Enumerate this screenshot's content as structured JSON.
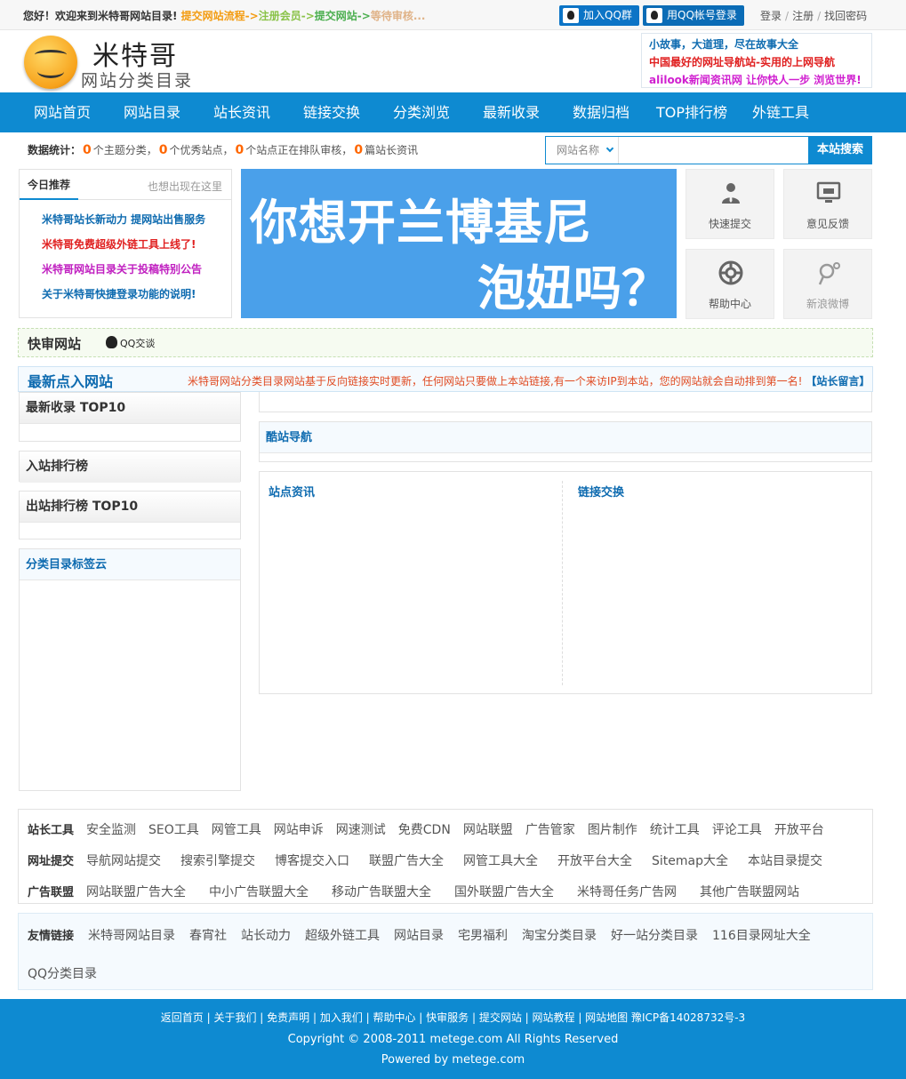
{
  "topbar": {
    "welcome": "您好！欢迎来到米特哥网站目录!",
    "steps": [
      "提交网站流程->",
      "注册会员->",
      "提交网站->",
      "等待审核..."
    ],
    "step_colors": [
      "#f39c12",
      "#8bc34a",
      "#4caf50",
      "#e0b388"
    ],
    "qq_group": "加入QQ群",
    "qq_login": "用QQ帐号登录",
    "links": [
      "登录",
      "注册",
      "找回密码"
    ]
  },
  "header": {
    "logo_name": "米特哥",
    "logo_sub": "网站分类目录",
    "ad_lines": [
      {
        "text": "小故事，大道理，尽在故事大全",
        "color": "#0e6bb0"
      },
      {
        "text": "中国最好的网址导航站-实用的上网导航",
        "color": "#e02020"
      },
      {
        "text": "alilook新闻资讯网 让你快人一步 浏览世界!",
        "color": "#d020d0"
      }
    ]
  },
  "nav": [
    "网站首页",
    "网站目录",
    "站长资讯",
    "链接交换",
    "分类浏览",
    "最新收录",
    "数据归档",
    "TOP排行榜",
    "外链工具"
  ],
  "stats": {
    "label": "数据统计：",
    "categories": "0",
    "categories_text": "个主题分类，",
    "sites": "0",
    "sites_text": "个优秀站点，",
    "pending": "0",
    "pending_text": "个站点正在排队审核，",
    "articles": "0",
    "articles_text": "篇站长资讯"
  },
  "search": {
    "select_label": "网站名称",
    "button": "本站搜索"
  },
  "recommend": {
    "tab_active": "今日推荐",
    "tab_other": "也想出现在这里",
    "items": [
      {
        "text": "米特哥站长新动力 提网站出售服务",
        "color": "#0e6bb0"
      },
      {
        "text": "米特哥免费超级外链工具上线了!",
        "color": "#e02020"
      },
      {
        "text": "米特哥网站目录关于投稿特别公告",
        "color": "#c020c0"
      },
      {
        "text": "关于米特哥快捷登录功能的说明!",
        "color": "#0e6bb0"
      }
    ]
  },
  "banner": {
    "line1": "你想开兰博基尼",
    "line2": "泡妞吗？"
  },
  "tiles": [
    "快速提交",
    "意见反馈",
    "帮助中心",
    "新浪微博"
  ],
  "quick_review": {
    "title": "快审网站",
    "qq": "QQ交谈"
  },
  "latest": {
    "title": "最新点入网站",
    "message": "米特哥网站分类目录网站基于反向链接实时更新，任何网站只要做上本站链接,有一个来访IP到本站，您的网站就会自动排到第一名!",
    "guestbook": "【站长留言】"
  },
  "sidebar": {
    "top10": "最新收录 TOP10",
    "in_rank": "入站排行榜",
    "out_rank": "出站排行榜 TOP10",
    "tags": "分类目录标签云"
  },
  "main": {
    "cool_nav": "酷站导航",
    "news": "站点资讯",
    "exchange": "链接交换"
  },
  "tools": {
    "rows": [
      {
        "label": "站长工具",
        "items": [
          "安全监测",
          "SEO工具",
          "网管工具",
          "网站申诉",
          "网速测试",
          "免费CDN",
          "网站联盟",
          "广告管家",
          "图片制作",
          "统计工具",
          "评论工具",
          "开放平台"
        ]
      },
      {
        "label": "网址提交",
        "items": [
          "导航网站提交",
          "搜索引擎提交",
          "博客提交入口",
          "联盟广告大全",
          "网管工具大全",
          "开放平台大全",
          "Sitemap大全",
          "本站目录提交"
        ]
      },
      {
        "label": "广告联盟",
        "items": [
          "网站联盟广告大全",
          "中小广告联盟大全",
          "移动广告联盟大全",
          "国外联盟广告大全",
          "米特哥任务广告网",
          "其他广告联盟网站"
        ]
      }
    ]
  },
  "friends": {
    "label": "友情链接",
    "items": [
      "米特哥网站目录",
      "春宵社",
      "站长动力",
      "超级外链工具",
      "网站目录",
      "宅男福利",
      "淘宝分类目录",
      "好一站分类目录",
      "116目录网址大全"
    ],
    "items2": [
      "QQ分类目录"
    ]
  },
  "footer": {
    "links": "返回首页 | 关于我们 | 免责声明 | 加入我们 | 帮助中心 | 快审服务 | 提交网站 | 网站教程 | 网站地图 豫ICP备14028732号-3",
    "copyright": "Copyright © 2008-2011 metege.com All Rights Reserved",
    "powered": "Powered by metege.com"
  }
}
